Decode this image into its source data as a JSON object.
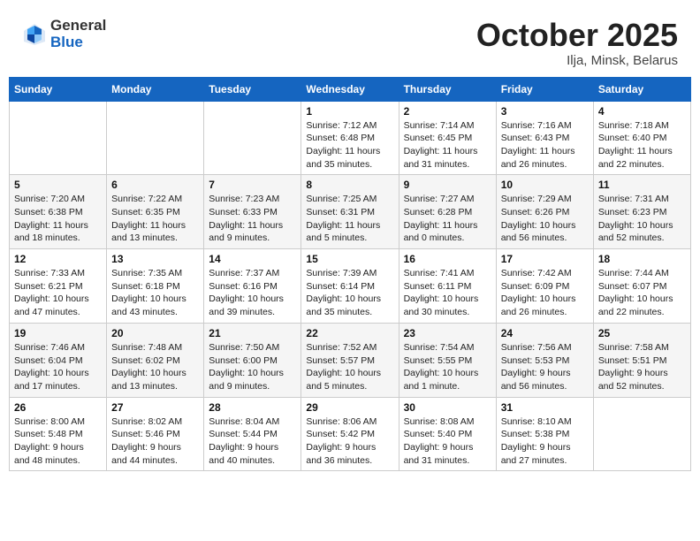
{
  "header": {
    "logo_general": "General",
    "logo_blue": "Blue",
    "month": "October 2025",
    "location": "Ilja, Minsk, Belarus"
  },
  "weekdays": [
    "Sunday",
    "Monday",
    "Tuesday",
    "Wednesday",
    "Thursday",
    "Friday",
    "Saturday"
  ],
  "weeks": [
    [
      {
        "day": "",
        "info": ""
      },
      {
        "day": "",
        "info": ""
      },
      {
        "day": "",
        "info": ""
      },
      {
        "day": "1",
        "info": "Sunrise: 7:12 AM\nSunset: 6:48 PM\nDaylight: 11 hours\nand 35 minutes."
      },
      {
        "day": "2",
        "info": "Sunrise: 7:14 AM\nSunset: 6:45 PM\nDaylight: 11 hours\nand 31 minutes."
      },
      {
        "day": "3",
        "info": "Sunrise: 7:16 AM\nSunset: 6:43 PM\nDaylight: 11 hours\nand 26 minutes."
      },
      {
        "day": "4",
        "info": "Sunrise: 7:18 AM\nSunset: 6:40 PM\nDaylight: 11 hours\nand 22 minutes."
      }
    ],
    [
      {
        "day": "5",
        "info": "Sunrise: 7:20 AM\nSunset: 6:38 PM\nDaylight: 11 hours\nand 18 minutes."
      },
      {
        "day": "6",
        "info": "Sunrise: 7:22 AM\nSunset: 6:35 PM\nDaylight: 11 hours\nand 13 minutes."
      },
      {
        "day": "7",
        "info": "Sunrise: 7:23 AM\nSunset: 6:33 PM\nDaylight: 11 hours\nand 9 minutes."
      },
      {
        "day": "8",
        "info": "Sunrise: 7:25 AM\nSunset: 6:31 PM\nDaylight: 11 hours\nand 5 minutes."
      },
      {
        "day": "9",
        "info": "Sunrise: 7:27 AM\nSunset: 6:28 PM\nDaylight: 11 hours\nand 0 minutes."
      },
      {
        "day": "10",
        "info": "Sunrise: 7:29 AM\nSunset: 6:26 PM\nDaylight: 10 hours\nand 56 minutes."
      },
      {
        "day": "11",
        "info": "Sunrise: 7:31 AM\nSunset: 6:23 PM\nDaylight: 10 hours\nand 52 minutes."
      }
    ],
    [
      {
        "day": "12",
        "info": "Sunrise: 7:33 AM\nSunset: 6:21 PM\nDaylight: 10 hours\nand 47 minutes."
      },
      {
        "day": "13",
        "info": "Sunrise: 7:35 AM\nSunset: 6:18 PM\nDaylight: 10 hours\nand 43 minutes."
      },
      {
        "day": "14",
        "info": "Sunrise: 7:37 AM\nSunset: 6:16 PM\nDaylight: 10 hours\nand 39 minutes."
      },
      {
        "day": "15",
        "info": "Sunrise: 7:39 AM\nSunset: 6:14 PM\nDaylight: 10 hours\nand 35 minutes."
      },
      {
        "day": "16",
        "info": "Sunrise: 7:41 AM\nSunset: 6:11 PM\nDaylight: 10 hours\nand 30 minutes."
      },
      {
        "day": "17",
        "info": "Sunrise: 7:42 AM\nSunset: 6:09 PM\nDaylight: 10 hours\nand 26 minutes."
      },
      {
        "day": "18",
        "info": "Sunrise: 7:44 AM\nSunset: 6:07 PM\nDaylight: 10 hours\nand 22 minutes."
      }
    ],
    [
      {
        "day": "19",
        "info": "Sunrise: 7:46 AM\nSunset: 6:04 PM\nDaylight: 10 hours\nand 17 minutes."
      },
      {
        "day": "20",
        "info": "Sunrise: 7:48 AM\nSunset: 6:02 PM\nDaylight: 10 hours\nand 13 minutes."
      },
      {
        "day": "21",
        "info": "Sunrise: 7:50 AM\nSunset: 6:00 PM\nDaylight: 10 hours\nand 9 minutes."
      },
      {
        "day": "22",
        "info": "Sunrise: 7:52 AM\nSunset: 5:57 PM\nDaylight: 10 hours\nand 5 minutes."
      },
      {
        "day": "23",
        "info": "Sunrise: 7:54 AM\nSunset: 5:55 PM\nDaylight: 10 hours\nand 1 minute."
      },
      {
        "day": "24",
        "info": "Sunrise: 7:56 AM\nSunset: 5:53 PM\nDaylight: 9 hours\nand 56 minutes."
      },
      {
        "day": "25",
        "info": "Sunrise: 7:58 AM\nSunset: 5:51 PM\nDaylight: 9 hours\nand 52 minutes."
      }
    ],
    [
      {
        "day": "26",
        "info": "Sunrise: 8:00 AM\nSunset: 5:48 PM\nDaylight: 9 hours\nand 48 minutes."
      },
      {
        "day": "27",
        "info": "Sunrise: 8:02 AM\nSunset: 5:46 PM\nDaylight: 9 hours\nand 44 minutes."
      },
      {
        "day": "28",
        "info": "Sunrise: 8:04 AM\nSunset: 5:44 PM\nDaylight: 9 hours\nand 40 minutes."
      },
      {
        "day": "29",
        "info": "Sunrise: 8:06 AM\nSunset: 5:42 PM\nDaylight: 9 hours\nand 36 minutes."
      },
      {
        "day": "30",
        "info": "Sunrise: 8:08 AM\nSunset: 5:40 PM\nDaylight: 9 hours\nand 31 minutes."
      },
      {
        "day": "31",
        "info": "Sunrise: 8:10 AM\nSunset: 5:38 PM\nDaylight: 9 hours\nand 27 minutes."
      },
      {
        "day": "",
        "info": ""
      }
    ]
  ]
}
